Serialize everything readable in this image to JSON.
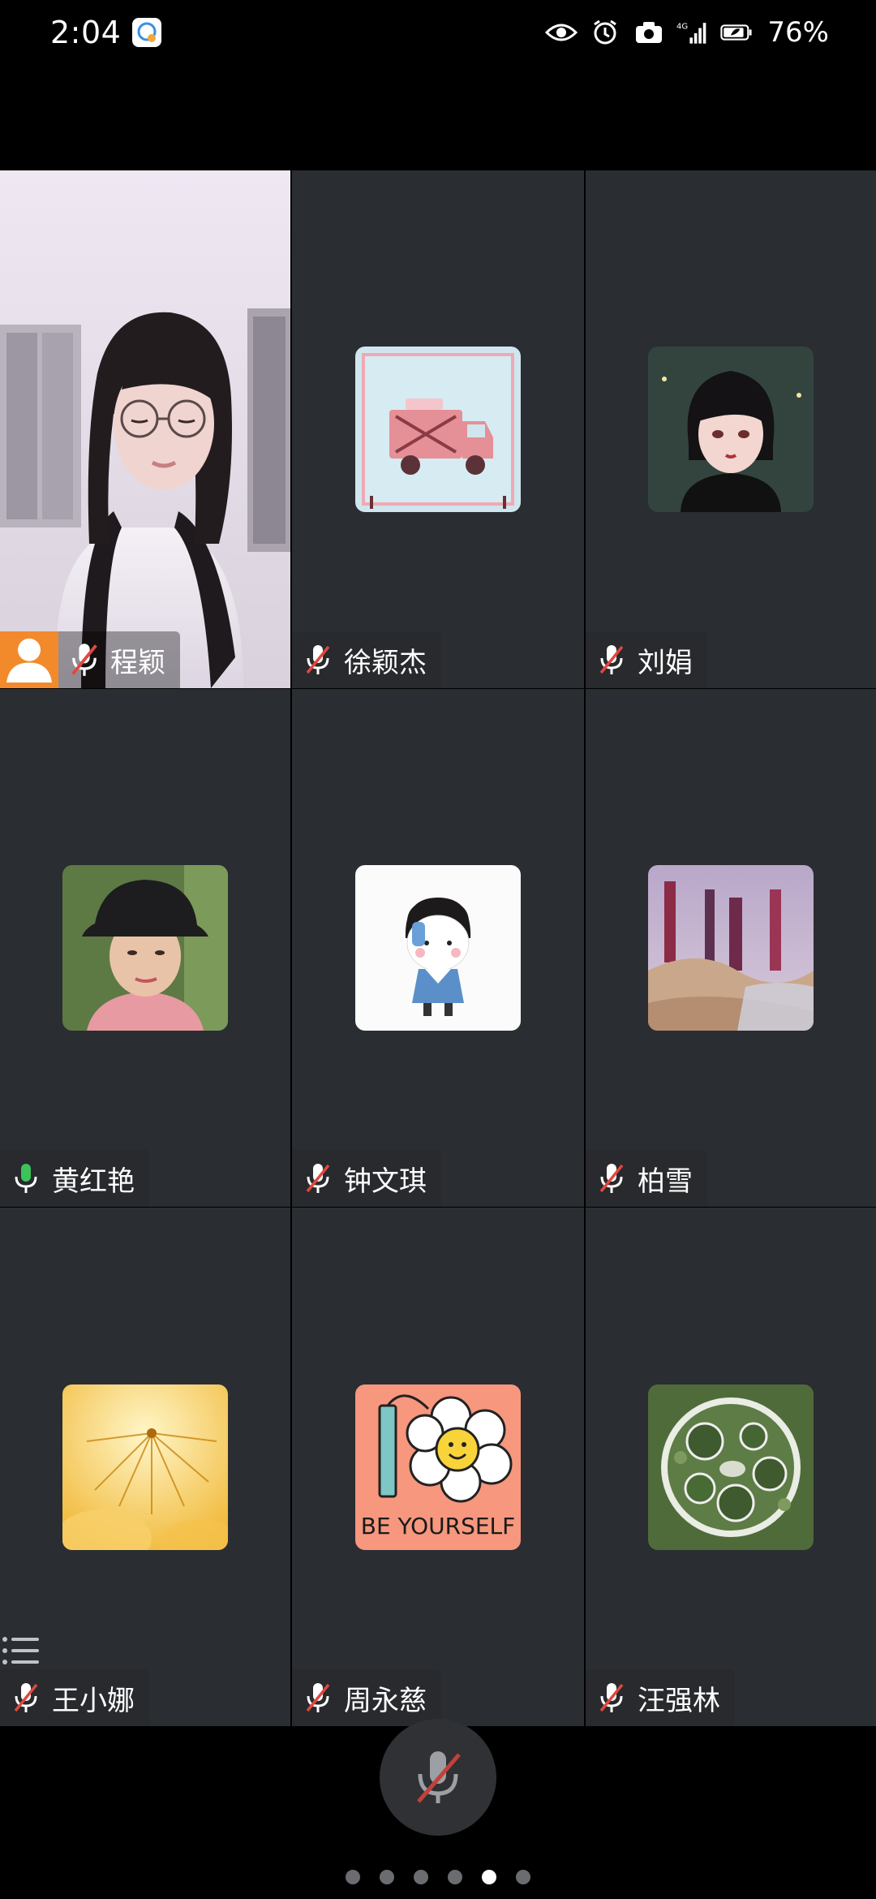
{
  "status_bar": {
    "time": "2:04",
    "battery_percent": "76%",
    "icons": [
      "eye-icon",
      "alarm-icon",
      "camera-icon",
      "4g-signal-icon",
      "battery-icon"
    ]
  },
  "participants": [
    {
      "name": "程颖",
      "mic": "muted",
      "avatar": "self-camera-video",
      "is_self": true
    },
    {
      "name": "徐颖杰",
      "mic": "muted",
      "avatar": "pink-truck-avatar"
    },
    {
      "name": "刘娟",
      "mic": "muted",
      "avatar": "anime-girl-avatar"
    },
    {
      "name": "黄红艳",
      "mic": "active",
      "avatar": "woman-hat-photo-avatar"
    },
    {
      "name": "钟文琪",
      "mic": "muted",
      "avatar": "cartoon-kid-avatar"
    },
    {
      "name": "柏雪",
      "mic": "muted",
      "avatar": "frosty-garden-avatar"
    },
    {
      "name": "王小娜",
      "mic": "muted",
      "avatar": "yellow-jellyfish-avatar"
    },
    {
      "name": "周永慈",
      "mic": "muted",
      "avatar": "be-yourself-flower-avatar",
      "avatar_text": "BE YOURSELF"
    },
    {
      "name": "汪强林",
      "mic": "muted",
      "avatar": "aerial-garden-avatar"
    }
  ],
  "pagination": {
    "total": 6,
    "active_index": 4
  },
  "colors": {
    "tile_bg": "#2a2d31",
    "self_badge": "#f28a2b",
    "mic_active": "#3cc35a",
    "mic_muted_slash": "#e0483e"
  }
}
